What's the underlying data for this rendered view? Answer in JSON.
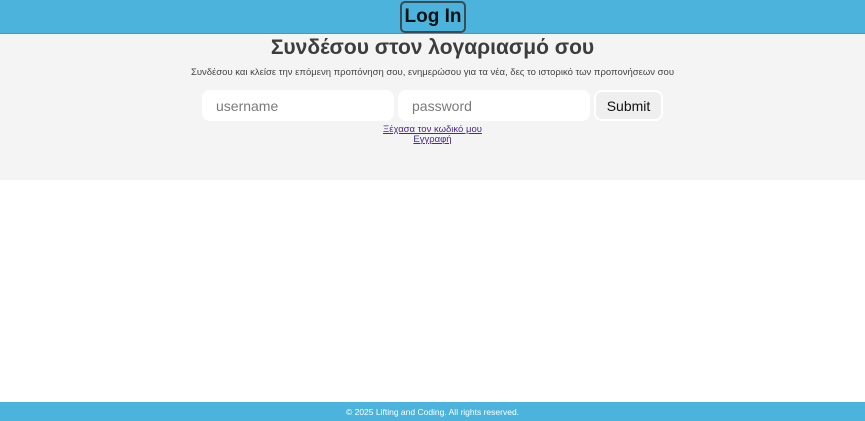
{
  "header": {
    "login_label": "Log In"
  },
  "main": {
    "title": "Συνδέσου στον λογαριασμό σου",
    "subtitle": "Συνδέσου και κλείσε την επόμενη προπόνηση σου, ενημερώσου για τα νέα, δες το ιστορικό των προπονήσεων σου",
    "form": {
      "username_placeholder": "username",
      "username_value": "",
      "password_placeholder": "password",
      "password_value": "",
      "submit_label": "Submit"
    },
    "links": {
      "forgot_password": "Ξέχασα τον κωδικό μου",
      "register": "Εγγραφή"
    }
  },
  "footer": {
    "copyright": "© 2025 Lifting and Coding. All rights reserved."
  },
  "colors": {
    "accent": "#4cb4dc",
    "panel": "#f4f4f4",
    "link": "#4a2a8a"
  }
}
